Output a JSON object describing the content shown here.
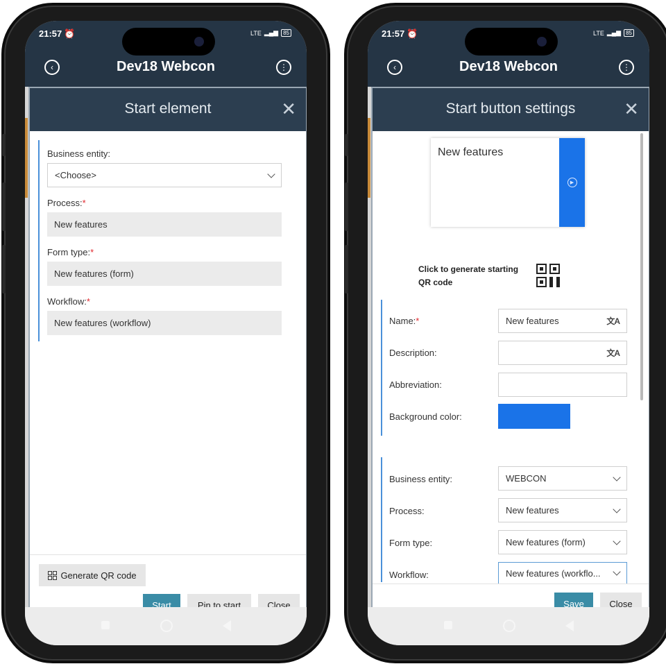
{
  "status": {
    "time": "21:57",
    "network": "LTE",
    "battery": "85"
  },
  "app": {
    "title": "Dev18 Webcon"
  },
  "left": {
    "dialog_title": "Start element",
    "business_entity": {
      "label": "Business entity:",
      "value": "<Choose>"
    },
    "process": {
      "label": "Process:",
      "value": "New features"
    },
    "form_type": {
      "label": "Form type:",
      "value": "New features (form)"
    },
    "workflow": {
      "label": "Workflow:",
      "value": "New features (workflow)"
    },
    "required_mark": "*",
    "buttons": {
      "qr": "Generate QR code",
      "start": "Start",
      "pin": "Pin to start",
      "close": "Close"
    }
  },
  "right": {
    "dialog_title": "Start button settings",
    "preview": {
      "label": "New features",
      "color": "#1a73e8"
    },
    "qr_hint": {
      "line1": "Click to generate starting",
      "line2": "QR code"
    },
    "name": {
      "label": "Name:",
      "value": "New features"
    },
    "description": {
      "label": "Description:",
      "value": ""
    },
    "abbreviation": {
      "label": "Abbreviation:",
      "value": ""
    },
    "background_color": {
      "label": "Background color:",
      "value": "#1a73e8"
    },
    "business_entity": {
      "label": "Business entity:",
      "value": "WEBCON"
    },
    "process": {
      "label": "Process:",
      "value": "New features"
    },
    "form_type": {
      "label": "Form type:",
      "value": "New features (form)"
    },
    "workflow": {
      "label": "Workflow:",
      "value": "New features (workflo..."
    },
    "required_mark": "*",
    "buttons": {
      "save": "Save",
      "close": "Close"
    }
  },
  "colors": {
    "appbar": "#253545",
    "dialog_header": "#2c3e50",
    "primary_button": "#3a8ca6",
    "accent_border": "#4a90d9"
  }
}
